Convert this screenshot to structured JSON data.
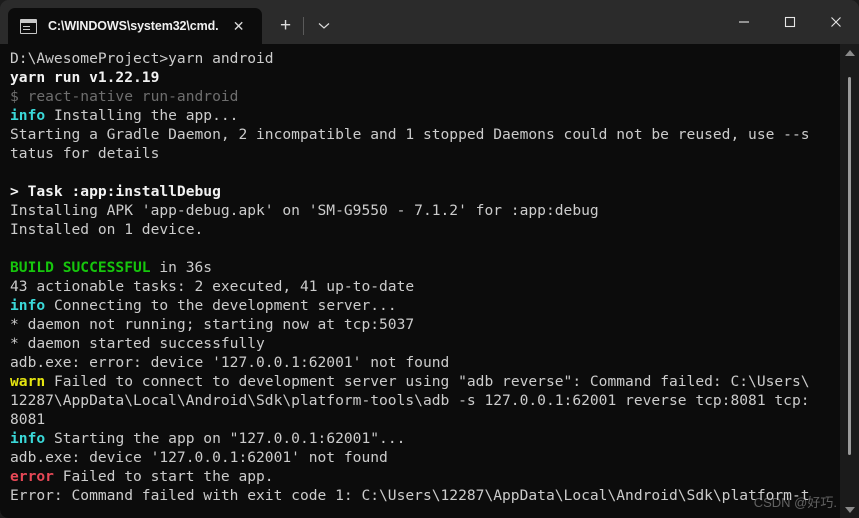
{
  "window": {
    "app": "windows-terminal",
    "background": "#0c0c0c",
    "titlebar_background": "#2b2b2b"
  },
  "titlebar": {
    "tab": {
      "title": "C:\\WINDOWS\\system32\\cmd.",
      "icon": "cmd-terminal-icon",
      "close_label": "✕"
    },
    "new_tab_label": "+",
    "dropdown_label": "⌄",
    "controls": {
      "minimize_label": "—",
      "maximize_label": "□",
      "close_label": "✕"
    }
  },
  "colors": {
    "default_text": "#cccccc",
    "bright_text": "#f2f2f2",
    "gray": "#6e6e6e",
    "cyan": "#3ad8d8",
    "green": "#16c60c",
    "yellow": "#e5e510",
    "red": "#e74856"
  },
  "terminal": {
    "lines": [
      {
        "id": "l01",
        "segments": [
          {
            "text": "D:\\AwesomeProject>yarn android",
            "color": "white"
          }
        ]
      },
      {
        "id": "l02",
        "segments": [
          {
            "text": "yarn run v1.22.19",
            "color": "bright"
          }
        ]
      },
      {
        "id": "l03",
        "segments": [
          {
            "text": "$ react-native run-android",
            "color": "gray"
          }
        ]
      },
      {
        "id": "l04",
        "segments": [
          {
            "text": "info",
            "color": "cyan"
          },
          {
            "text": " Installing the app...",
            "color": "white"
          }
        ]
      },
      {
        "id": "l05",
        "segments": [
          {
            "text": "Starting a Gradle Daemon, 2 incompatible and 1 stopped Daemons could not be reused, use --s",
            "color": "white"
          }
        ]
      },
      {
        "id": "l06",
        "segments": [
          {
            "text": "tatus for details",
            "color": "white"
          }
        ]
      },
      {
        "id": "l07",
        "segments": [
          {
            "text": "",
            "color": "white"
          }
        ]
      },
      {
        "id": "l08",
        "segments": [
          {
            "text": "> Task :app:installDebug",
            "color": "bright"
          }
        ]
      },
      {
        "id": "l09",
        "segments": [
          {
            "text": "Installing APK 'app-debug.apk' on 'SM-G9550 - 7.1.2' for :app:debug",
            "color": "white"
          }
        ]
      },
      {
        "id": "l10",
        "segments": [
          {
            "text": "Installed on 1 device.",
            "color": "white"
          }
        ]
      },
      {
        "id": "l11",
        "segments": [
          {
            "text": "",
            "color": "white"
          }
        ]
      },
      {
        "id": "l12",
        "segments": [
          {
            "text": "BUILD SUCCESSFUL",
            "color": "green"
          },
          {
            "text": " in 36s",
            "color": "white"
          }
        ]
      },
      {
        "id": "l13",
        "segments": [
          {
            "text": "43 actionable tasks: 2 executed, 41 up-to-date",
            "color": "white"
          }
        ]
      },
      {
        "id": "l14",
        "segments": [
          {
            "text": "info",
            "color": "cyan"
          },
          {
            "text": " Connecting to the development server...",
            "color": "white"
          }
        ]
      },
      {
        "id": "l15",
        "segments": [
          {
            "text": "* daemon not running; starting now at tcp:5037",
            "color": "white"
          }
        ]
      },
      {
        "id": "l16",
        "segments": [
          {
            "text": "* daemon started successfully",
            "color": "white"
          }
        ]
      },
      {
        "id": "l17",
        "segments": [
          {
            "text": "adb.exe: error: device '127.0.0.1:62001' not found",
            "color": "white"
          }
        ]
      },
      {
        "id": "l18",
        "segments": [
          {
            "text": "warn",
            "color": "yellow"
          },
          {
            "text": " Failed to connect to development server using \"adb reverse\": Command failed: C:\\Users\\",
            "color": "white"
          }
        ]
      },
      {
        "id": "l19",
        "segments": [
          {
            "text": "12287\\AppData\\Local\\Android\\Sdk\\platform-tools\\adb -s 127.0.0.1:62001 reverse tcp:8081 tcp:",
            "color": "white"
          }
        ]
      },
      {
        "id": "l20",
        "segments": [
          {
            "text": "8081",
            "color": "white"
          }
        ]
      },
      {
        "id": "l21",
        "segments": [
          {
            "text": "info",
            "color": "cyan"
          },
          {
            "text": " Starting the app on \"127.0.0.1:62001\"...",
            "color": "white"
          }
        ]
      },
      {
        "id": "l22",
        "segments": [
          {
            "text": "adb.exe: device '127.0.0.1:62001' not found",
            "color": "white"
          }
        ]
      },
      {
        "id": "l23",
        "segments": [
          {
            "text": "error",
            "color": "red"
          },
          {
            "text": " Failed to start the app.",
            "color": "white"
          }
        ]
      },
      {
        "id": "l24",
        "segments": [
          {
            "text": "Error: Command failed with exit code 1: C:\\Users\\12287\\AppData\\Local\\Android\\Sdk\\platform-t",
            "color": "white"
          }
        ]
      }
    ]
  },
  "scrollbar": {
    "up_arrow": "scroll-up-arrow",
    "down_arrow": "scroll-down-arrow"
  },
  "watermark": {
    "text": "CSDN @好巧."
  }
}
